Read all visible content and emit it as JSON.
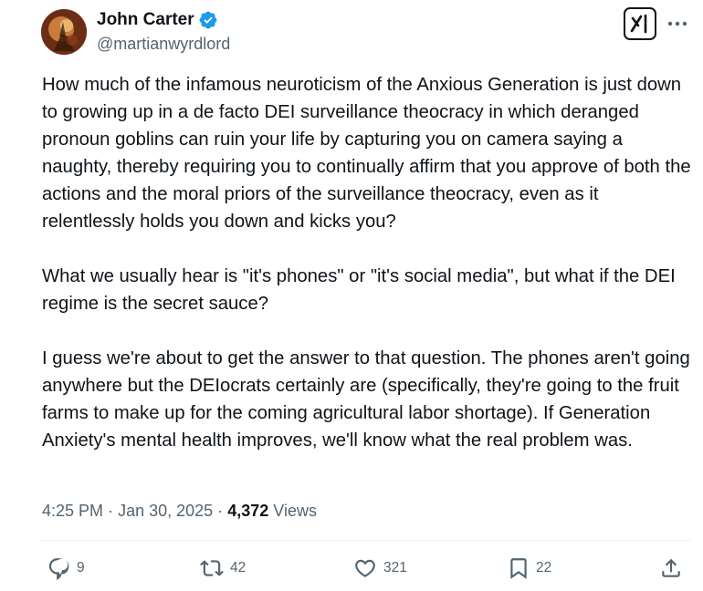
{
  "author": {
    "display_name": "John Carter",
    "handle": "@martianwyrdlord",
    "verified": true,
    "avatar_icon": "profile-avatar"
  },
  "header": {
    "grok_icon": "grok-icon",
    "more_icon": "more-options-icon"
  },
  "post": {
    "paragraphs": [
      "How much of the infamous neuroticism of the Anxious Generation is just down to growing up in a de facto DEI surveillance theocracy in which deranged pronoun goblins can ruin your life by capturing you on camera saying a naughty, thereby requiring you to continually affirm that you approve of both the actions and the moral priors of the surveillance theocracy, even as it relentlessly holds you down and kicks you?",
      "What we usually hear is \"it's phones\" or \"it's social media\", but what if the DEI regime is the secret sauce?",
      "I guess we're about to get the answer to that question. The phones aren't going anywhere but the DEIocrats certainly are (specifically, they're going to the fruit farms to make up for the coming agricultural labor shortage). If Generation Anxiety's mental health improves, we'll know what the real problem was."
    ]
  },
  "meta": {
    "time": "4:25 PM",
    "separator": "·",
    "date": "Jan 30, 2025",
    "views_count": "4,372",
    "views_label": "Views"
  },
  "actions": {
    "replies": "9",
    "reposts": "42",
    "likes": "321",
    "bookmarks": "22"
  },
  "colors": {
    "text_primary": "#0f1419",
    "text_secondary": "#536471",
    "verified_blue": "#1d9bf0",
    "divider": "#eff3f4"
  }
}
